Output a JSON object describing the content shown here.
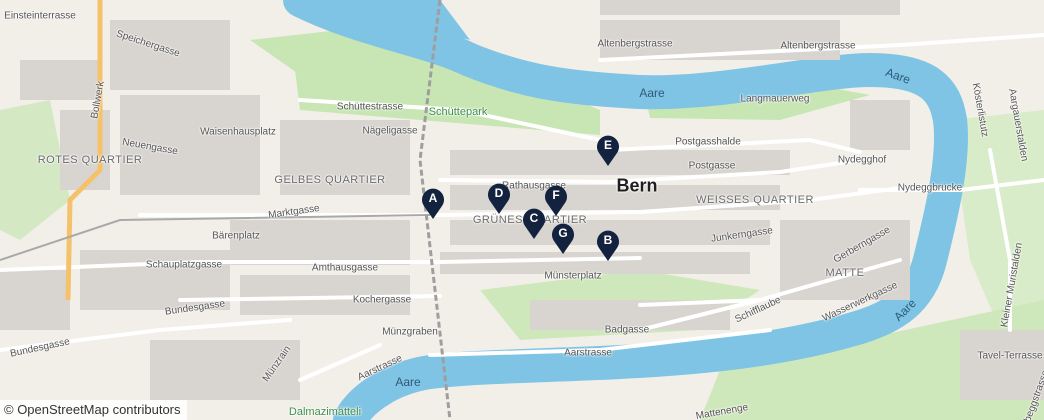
{
  "map": {
    "city": "Bern",
    "attribution": "© OpenStreetMap contributors",
    "colors": {
      "water": "#7fc4e5",
      "park": "#c8e6b4",
      "block": "#d8d4cf",
      "road": "#ffffff",
      "land": "#f2efe9",
      "marker": "#13233f",
      "highway": "#f5c26b"
    },
    "quarters": [
      "ROTES QUARTIER",
      "GELBES QUARTIER",
      "GRÜNES QUARTIER",
      "WEISSES QUARTIER",
      "MATTE"
    ],
    "water_labels": [
      "Aare",
      "Aare",
      "Aare",
      "Aare"
    ],
    "parks": [
      "Schüttepark",
      "Dalmazimätteli"
    ],
    "streets": [
      "Einsteinterrasse",
      "Speichergasse",
      "Bollwerk",
      "Neuengasse",
      "Waisenhausplatz",
      "Schüttestrasse",
      "Nägeligasse",
      "Altenbergstrasse",
      "Altenbergstrasse",
      "Langmauerweg",
      "Postgasshalde",
      "Postgasse",
      "Nydegghof",
      "Rathausgasse",
      "Nydeggbrücke",
      "Marktgasse",
      "Bärenplatz",
      "Junkerngasse",
      "Gerberngasse",
      "Münsterplatz",
      "Amthausgasse",
      "Schauplatzgasse",
      "Kochergasse",
      "Bundesgasse",
      "Bundesgasse",
      "Münzgraben",
      "Münzrain",
      "Badgasse",
      "Schifflaube",
      "Wasserwerkgasse",
      "Aarstrasse",
      "Aarstrasse",
      "Kösterlistutz",
      "Aargauerstalden",
      "Kleiner Muristalden",
      "Tavel-Terrasse",
      "Laubeggstrasse",
      "Mattenenge"
    ],
    "markers": [
      "A",
      "B",
      "C",
      "D",
      "E",
      "F",
      "G"
    ]
  }
}
